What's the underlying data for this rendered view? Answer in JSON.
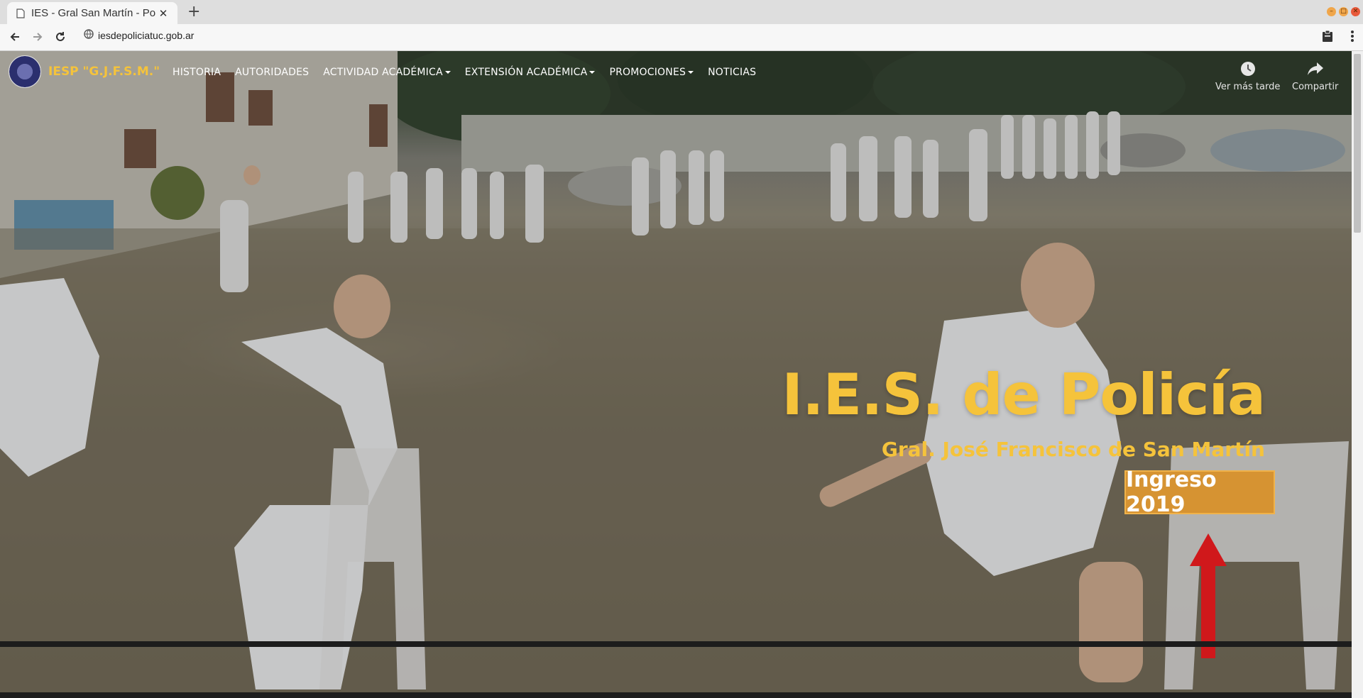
{
  "browser": {
    "tab_title": "IES - Gral San Martín - Po",
    "url": "iesdepoliciatuc.gob.ar"
  },
  "site": {
    "brand": "IESP \"G.J.F.S.M.\"",
    "menu": [
      {
        "label": "HISTORIA",
        "dropdown": false
      },
      {
        "label": "AUTORIDADES",
        "dropdown": false
      },
      {
        "label": "ACTIVIDAD ACADÉMICA",
        "dropdown": true
      },
      {
        "label": "EXTENSIÓN ACADÉMICA",
        "dropdown": true
      },
      {
        "label": "PROMOCIONES",
        "dropdown": true
      },
      {
        "label": "NOTICIAS",
        "dropdown": false
      }
    ],
    "video_actions": {
      "watch_later": "Ver más tarde",
      "share": "Compartir"
    }
  },
  "hero": {
    "title": "I.E.S. de Policía",
    "subtitle": "Gral. José Francisco de San Martín",
    "cta": "Ingreso 2019"
  },
  "colors": {
    "accent": "#f5c33b",
    "cta_bg": "#d69332",
    "arrow": "#d0181b"
  }
}
